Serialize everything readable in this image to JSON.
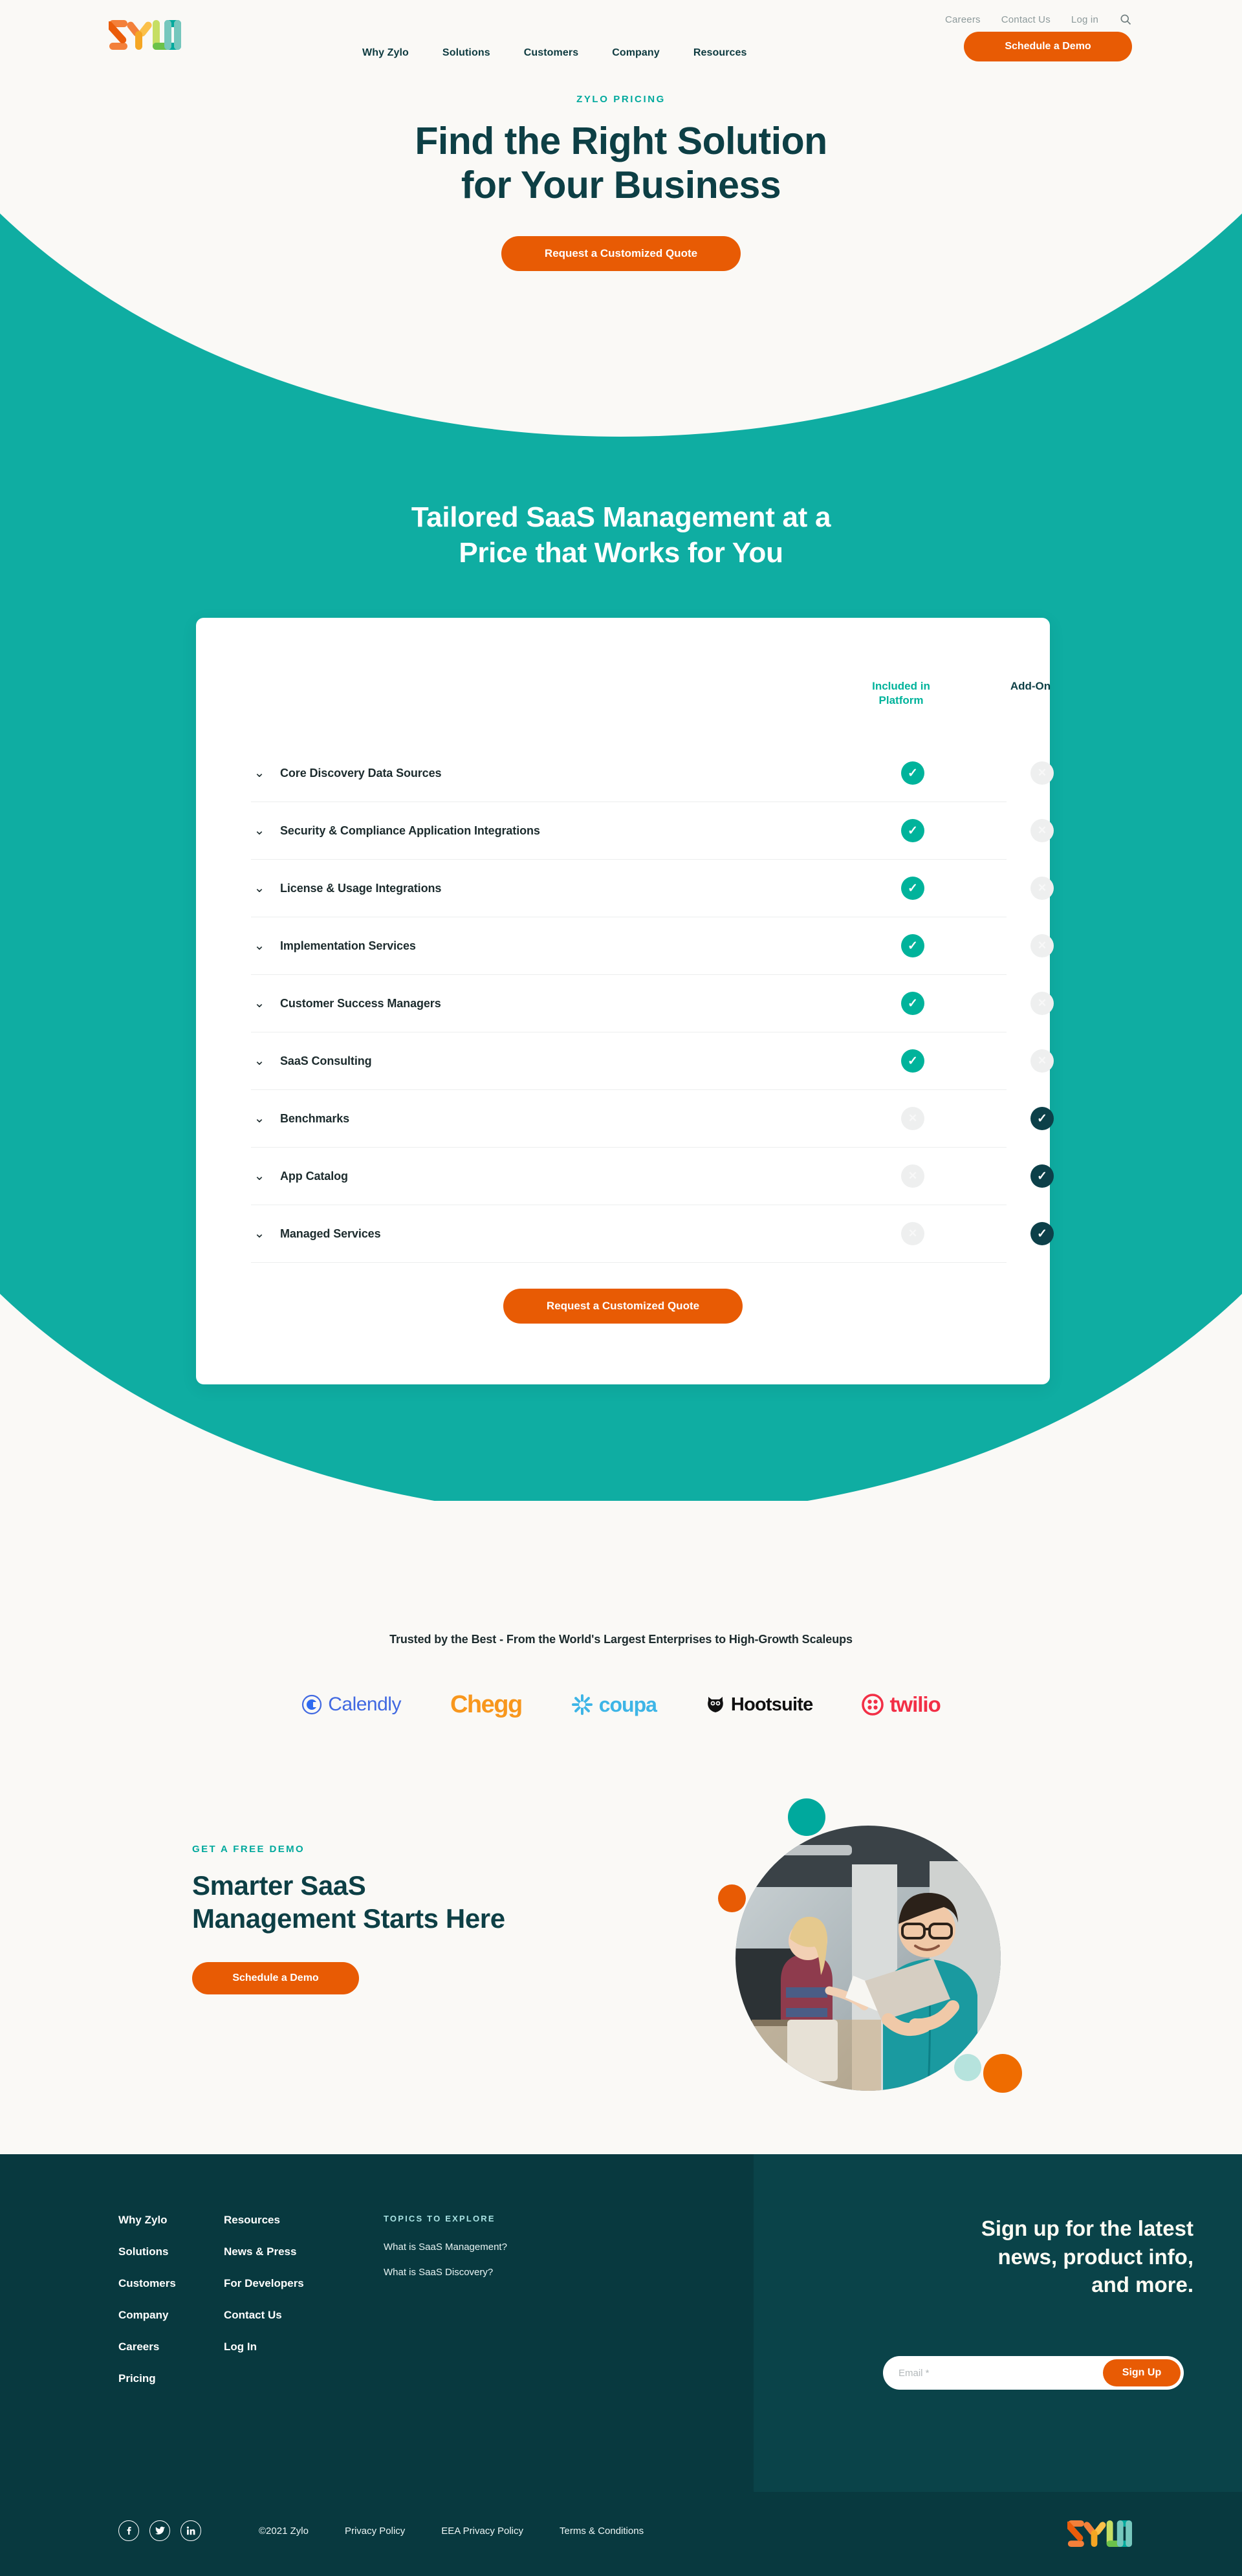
{
  "brand": {
    "name": "Zylo",
    "colors": {
      "teal": "#00a99d",
      "dark_teal": "#0d3f45",
      "orange": "#e85b04",
      "mint": "#b6e3dd"
    }
  },
  "header": {
    "logo_alt": "Zylo",
    "utility": [
      {
        "label": "Careers"
      },
      {
        "label": "Contact Us"
      },
      {
        "label": "Log in"
      }
    ],
    "search_icon": "search-icon",
    "nav": [
      {
        "label": "Why Zylo"
      },
      {
        "label": "Solutions"
      },
      {
        "label": "Customers"
      },
      {
        "label": "Company"
      },
      {
        "label": "Resources"
      }
    ],
    "cta": "Schedule a Demo"
  },
  "hero": {
    "eyebrow": "ZYLO PRICING",
    "title_line1": "Find the Right Solution",
    "title_line2": "for Your Business",
    "cta": "Request a Customized Quote"
  },
  "pricing": {
    "section_title_line1": "Tailored SaaS Management at a",
    "section_title_line2": "Price that Works for You",
    "columns": {
      "included": "Included in Platform",
      "addon": "Add-On"
    },
    "rows": [
      {
        "label": "Core Discovery Data Sources",
        "included": "check",
        "addon": "cross"
      },
      {
        "label": "Security & Compliance Application Integrations",
        "included": "check",
        "addon": "cross"
      },
      {
        "label": "License & Usage Integrations",
        "included": "check",
        "addon": "cross"
      },
      {
        "label": "Implementation Services",
        "included": "check",
        "addon": "cross"
      },
      {
        "label": "Customer Success Managers",
        "included": "check",
        "addon": "cross"
      },
      {
        "label": "SaaS Consulting",
        "included": "check",
        "addon": "cross"
      },
      {
        "label": "Benchmarks",
        "included": "cross",
        "addon": "check"
      },
      {
        "label": "App Catalog",
        "included": "cross",
        "addon": "check"
      },
      {
        "label": "Managed Services",
        "included": "cross",
        "addon": "check"
      }
    ],
    "expand_icon": "chevron-down-icon",
    "cta": "Request a Customized Quote"
  },
  "trusted": {
    "title": "Trusted by the Best - From the World's Largest Enterprises to High-Growth Scaleups",
    "logos": [
      {
        "name": "Calendly"
      },
      {
        "name": "Chegg"
      },
      {
        "name": "coupa"
      },
      {
        "name": "Hootsuite"
      },
      {
        "name": "twilio"
      }
    ]
  },
  "demo": {
    "eyebrow": "GET A FREE DEMO",
    "title_line1": "Smarter SaaS",
    "title_line2": "Management Starts Here",
    "cta": "Schedule a Demo",
    "image_alt": "two colleagues in an office, man holding a tablet"
  },
  "footer": {
    "col1": [
      {
        "label": "Why Zylo"
      },
      {
        "label": "Solutions"
      },
      {
        "label": "Customers"
      },
      {
        "label": "Company"
      },
      {
        "label": "Careers"
      },
      {
        "label": "Pricing"
      }
    ],
    "col2": [
      {
        "label": "Resources"
      },
      {
        "label": "News & Press"
      },
      {
        "label": "For Developers"
      },
      {
        "label": "Contact Us"
      },
      {
        "label": "Log In"
      }
    ],
    "topics_heading": "TOPICS TO EXPLORE",
    "topics": [
      {
        "label": "What is SaaS Management?"
      },
      {
        "label": "What is SaaS Discovery?"
      }
    ],
    "signup": {
      "heading_line1": "Sign up for the latest",
      "heading_line2": "news, product info,",
      "heading_line3": "and more.",
      "email_placeholder": "Email *",
      "email_value": "",
      "button": "Sign Up"
    },
    "social": [
      {
        "name": "facebook-icon",
        "glyph": "f"
      },
      {
        "name": "twitter-icon",
        "glyph": "t"
      },
      {
        "name": "linkedin-icon",
        "glyph": "in"
      }
    ],
    "copyright": "©2021 Zylo",
    "legal": [
      {
        "label": "Privacy Policy"
      },
      {
        "label": "EEA Privacy Policy"
      },
      {
        "label": "Terms & Conditions"
      }
    ]
  }
}
